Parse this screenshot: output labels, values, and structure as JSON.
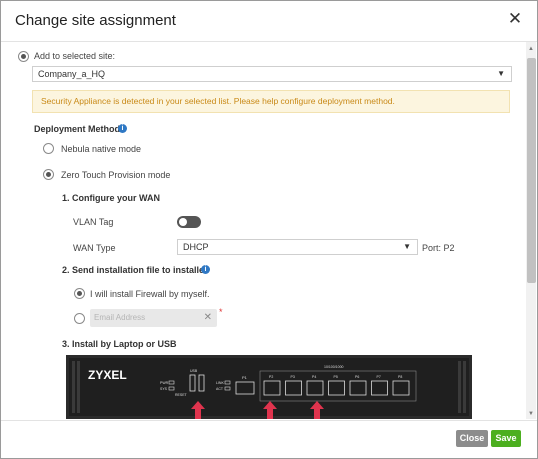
{
  "dialog": {
    "title": "Change site assignment",
    "close_icon": "close-icon"
  },
  "site": {
    "radio_label": "Add to selected site:",
    "selected": "Company_a_HQ"
  },
  "warning": "Security Appliance is detected in your selected list. Please help configure deployment method.",
  "deployment": {
    "label": "Deployment Method",
    "option_native": "Nebula native mode",
    "option_ztp": "Zero Touch Provision mode"
  },
  "wan": {
    "heading": "1. Configure your WAN",
    "vlan_label": "VLAN Tag",
    "type_label": "WAN Type",
    "type_value": "DHCP",
    "port_text": "Port: P2"
  },
  "install_file": {
    "heading": "2. Send installation file to installer",
    "option_self": "I will install Firewall by myself.",
    "email_placeholder": "Email Address",
    "required_mark": "*"
  },
  "laptop": {
    "heading": "3. Install by Laptop or USB",
    "device_brand": "ZYXEL",
    "device_labels": {
      "pwr": "PWR",
      "sys": "SYS",
      "usb": "USB",
      "reset": "RESET",
      "lan": "LINK",
      "act": "ACT",
      "p1": "P1",
      "ports_header": "10/100/1000",
      "ports": [
        "P2",
        "P3",
        "P4",
        "P5",
        "P6",
        "P7",
        "P8"
      ]
    }
  },
  "footer": {
    "close_label": "Close",
    "save_label": "Save"
  },
  "colors": {
    "warning_bg": "#fcf5df",
    "warning_text": "#c98a18",
    "save_button": "#4caf1f",
    "close_button": "#8c8c8c",
    "info_icon": "#2f78c4",
    "arrow": "#e0344e"
  }
}
